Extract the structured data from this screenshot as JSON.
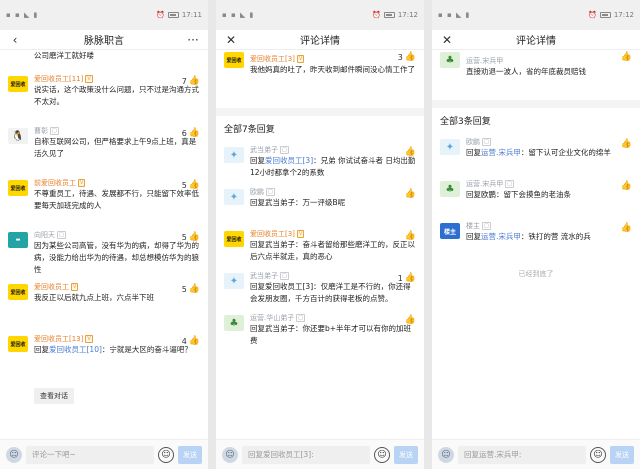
{
  "panel1": {
    "status": {
      "time": "17:11"
    },
    "title": "脉脉职言",
    "top_text": "公司磨洋工就好喽",
    "comments": [
      {
        "name": "爱回收员工[11]",
        "avatar": "爱回收",
        "av": "yellow",
        "text": "说实话，这个政策没什么问题，只不过是沟通方式不太对。",
        "likes": "7"
      },
      {
        "name": "曹彰",
        "avatar": "🐧",
        "av": "penguin",
        "text": "自称互联网公司，但严格要求上午9点上班，真是活久见了",
        "likes": "6"
      },
      {
        "name": "前爱回收员工",
        "avatar": "爱回收",
        "av": "yellow",
        "text": "不尊重员工，待遇、发展都不行，只能留下效率低要每天加班完成的人",
        "likes": "5"
      },
      {
        "name": "向阳天",
        "avatar": "▬",
        "av": "teal",
        "text": "因为某些公司高管，没有华为的病，却得了华为的病，没能力给出华为的待遇，却总想模仿华为的狼性",
        "likes": "5"
      },
      {
        "name": "爱回收员工",
        "avatar": "爱回收",
        "av": "yellow",
        "text": "我反正以后就九点上班，六点半下班",
        "likes": "5"
      },
      {
        "name": "爱回收员工[13]",
        "avatar": "爱回收",
        "av": "yellow",
        "text_pre": "回复",
        "ref": "爱回收员工[10]",
        "text_post": "：宁就是大区的奋斗逼吧？",
        "likes": "4"
      }
    ],
    "view_conversation": "查看对话",
    "input_placeholder": "评论一下吧~",
    "send": "发送"
  },
  "panel2": {
    "status": {
      "time": "17:12"
    },
    "title": "评论详情",
    "main": {
      "name": "爱回收员工[3]",
      "avatar": "爱回收",
      "text": "我他妈真的吐了，昨天收到邮件瞬间没心情工作了",
      "likes": "3"
    },
    "section": "全部7条回复",
    "replies": [
      {
        "name": "武当弟子",
        "avatar": "✦",
        "av": "bird",
        "pre": "回复",
        "ref": "爱回收员工[3]",
        "post": "：兄弟 你试试奋斗者 日均出勤12小时都拿个2的系数",
        "likes": ""
      },
      {
        "name": "欧鹏",
        "avatar": "✦",
        "av": "bird",
        "pre": "",
        "ref": "",
        "post": "回复武当弟子：万一评级B呢",
        "likes": ""
      },
      {
        "name": "爱回收员工[3]",
        "avatar": "爱回收",
        "av": "yellow",
        "pre": "",
        "ref": "",
        "post": "回复武当弟子：奋斗者留给那些磨洋工的，反正以后六点半就走，真的恶心",
        "likes": ""
      },
      {
        "name": "武当弟子",
        "avatar": "✦",
        "av": "bird",
        "pre": "",
        "ref": "",
        "post": "回复爱回收员工[3]：仅磨洋工是不行的，你还得会发朋友圈，千方百计的获得老板的点赞。",
        "likes": "1"
      },
      {
        "name": "运营.华山弟子",
        "avatar": "♣",
        "av": "green",
        "pre": "",
        "ref": "",
        "post": "回复武当弟子：你还要b+半年才可以有你的加班费",
        "likes": ""
      }
    ],
    "input_placeholder": "回复爱回收员工[3]:",
    "send": "发送"
  },
  "panel3": {
    "status": {
      "time": "17:12"
    },
    "title": "评论详情",
    "main": {
      "name": "运营.宋兵甲",
      "avatar": "♣",
      "text": "直接劝退一波人，省的年底裁员赔钱",
      "likes": ""
    },
    "section": "全部3条回复",
    "replies": [
      {
        "name": "欧鹏",
        "avatar": "✦",
        "av": "bird",
        "pre": "回复",
        "ref": "运营.宋兵甲",
        "post": "：留下认可企业文化的绵羊"
      },
      {
        "name": "运营.宋兵甲",
        "avatar": "♣",
        "av": "green",
        "pre": "",
        "ref": "",
        "post": "回复欧鹏：留下会摸鱼的老油条"
      },
      {
        "name": "楼主",
        "avatar": "楼主",
        "av": "blue",
        "pre": "回复",
        "ref": "运营.宋兵甲",
        "post": "：铁打的营 流水的兵"
      }
    ],
    "end": "已经到底了",
    "input_placeholder": "回复运营.宋兵甲:",
    "send": "发送"
  }
}
